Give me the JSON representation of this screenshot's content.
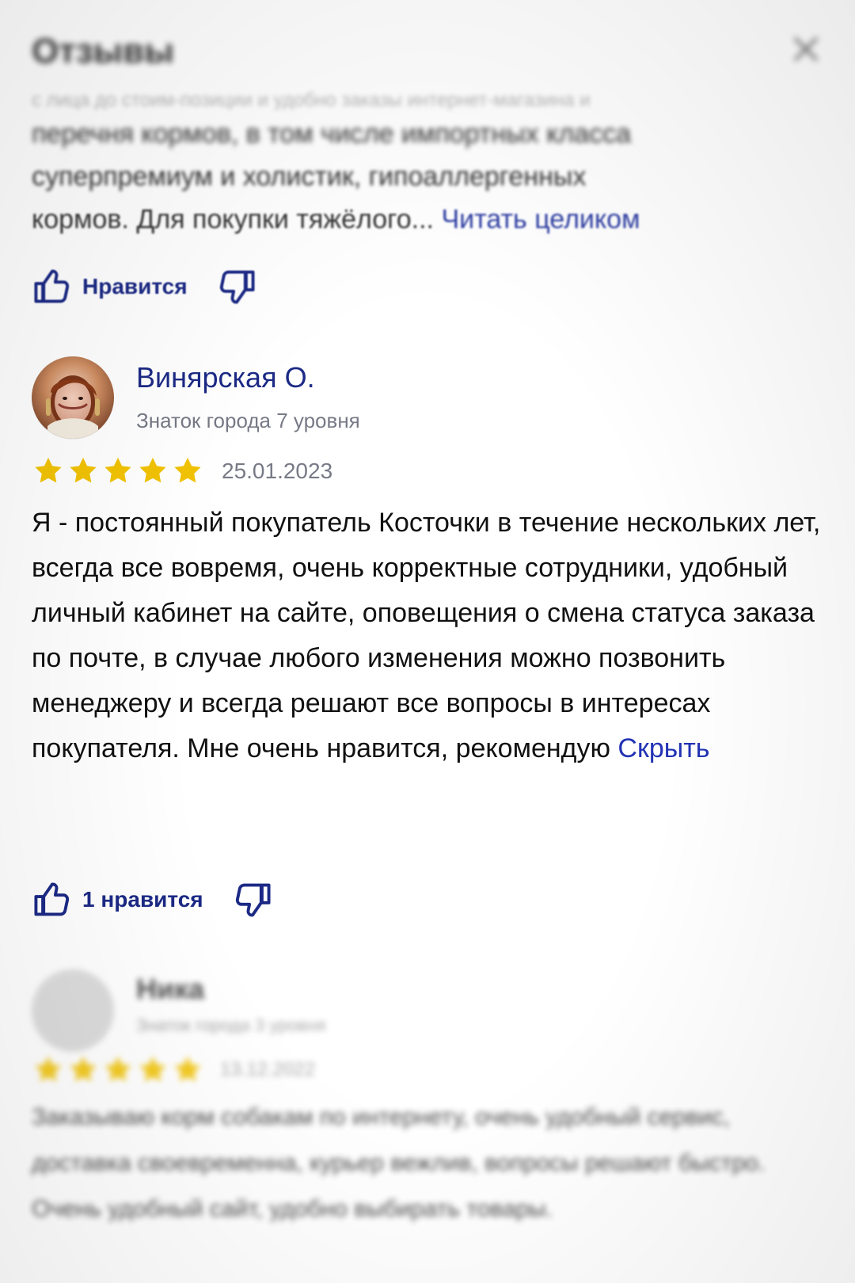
{
  "header": {
    "title": "Отзывы",
    "close_icon": "close-icon"
  },
  "previous_review": {
    "lines": [
      "с лица до стоим-позиции и удобно заказы интернет-магазина и",
      "перечня кормов, в том числе импортных класса",
      "суперпремиум и холистик, гипоаллергенных",
      "кормов. Для покупки тяжёлого..."
    ],
    "read_more_label": "Читать целиком",
    "reactions": {
      "like_label": "Нравится",
      "like_icon": "thumb-up-icon",
      "dislike_icon": "thumb-down-icon"
    }
  },
  "review": {
    "author": "Винярская О.",
    "level": "Знаток города 7 уровня",
    "rating": 5,
    "date": "25.01.2023",
    "text": "Я - постоянный покупатель Косточки в течение нескольких лет, всегда все вовремя, очень корректные сотрудники, удобный личный кабинет на сайте, оповещения о смена статуса заказа по почте, в случае любого изменения можно позвонить менеджеру и всегда решают все вопросы в интересах покупателя. Мне очень нравится, рекомендую",
    "hide_label": "Скрыть",
    "reactions": {
      "like_label": "1 нравится",
      "like_icon": "thumb-up-icon",
      "dislike_icon": "thumb-down-icon"
    },
    "avatar_icon": "user-avatar"
  },
  "next_review": {
    "author": "Ника",
    "level": "Знаток города 3 уровня",
    "rating": 5,
    "date": "13.12.2022",
    "text": "Заказываю корм собакам по интернету, очень удобный сервис, доставка своевременна, курьер вежлив, вопросы решают быстро. Очень удобный сайт, удобно выбирать товары.",
    "avatar_icon": "default-avatar-icon"
  },
  "colors": {
    "accent": "#1c2a86",
    "link": "#2233b5",
    "star": "#f2c300",
    "muted": "#777a86"
  }
}
